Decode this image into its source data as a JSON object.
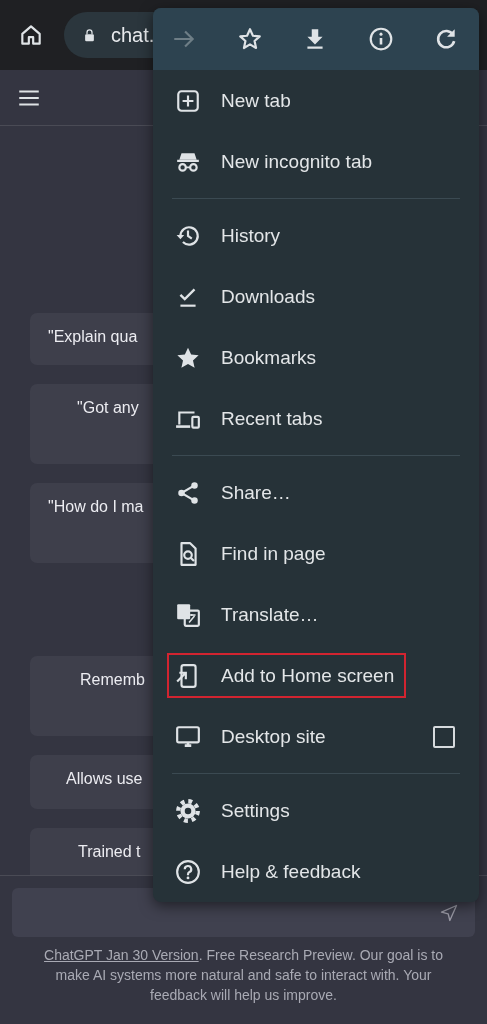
{
  "toolbar": {
    "url": "chat."
  },
  "suggestions": [
    {
      "text": "\"Explain qua"
    },
    {
      "text": "\"Got any"
    },
    {
      "text": "\"How do I ma"
    },
    {
      "text": "Rememb"
    },
    {
      "text": "Allows use"
    },
    {
      "text": "Trained t"
    }
  ],
  "footer": {
    "link": "ChatGPT Jan 30 Version",
    "text": ". Free Research Preview. Our goal is to make AI systems more natural and safe to interact with. Your feedback will help us improve."
  },
  "menu": {
    "actions": [
      {
        "kind": "forward",
        "disabled": true
      },
      {
        "kind": "bookmark",
        "disabled": false
      },
      {
        "kind": "download",
        "disabled": false
      },
      {
        "kind": "info",
        "disabled": false
      },
      {
        "kind": "reload",
        "disabled": false
      }
    ],
    "groups": [
      {
        "items": [
          {
            "kind": "new-tab",
            "label": "New tab",
            "highlighted": false
          },
          {
            "kind": "incognito",
            "label": "New incognito tab",
            "highlighted": false
          }
        ]
      },
      {
        "items": [
          {
            "kind": "history",
            "label": "History",
            "highlighted": false
          },
          {
            "kind": "downloads",
            "label": "Downloads",
            "highlighted": false
          },
          {
            "kind": "bookmarks",
            "label": "Bookmarks",
            "highlighted": false
          },
          {
            "kind": "recent-tabs",
            "label": "Recent tabs",
            "highlighted": false
          }
        ]
      },
      {
        "items": [
          {
            "kind": "share",
            "label": "Share…",
            "highlighted": false
          },
          {
            "kind": "find",
            "label": "Find in page",
            "highlighted": false
          },
          {
            "kind": "translate",
            "label": "Translate…",
            "highlighted": false
          },
          {
            "kind": "add-home",
            "label": "Add to Home screen",
            "highlighted": true
          },
          {
            "kind": "desktop",
            "label": "Desktop site",
            "highlighted": false,
            "checked": false
          }
        ]
      },
      {
        "items": [
          {
            "kind": "settings",
            "label": "Settings",
            "highlighted": false
          },
          {
            "kind": "help",
            "label": "Help & feedback",
            "highlighted": false
          }
        ]
      }
    ]
  }
}
